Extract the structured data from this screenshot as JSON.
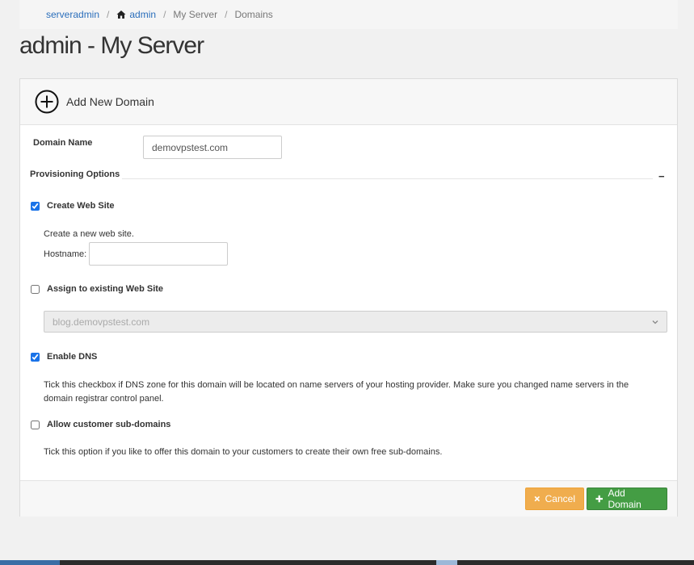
{
  "breadcrumb": {
    "items": [
      "serveradmin",
      "admin",
      "My Server",
      "Domains"
    ],
    "separator": "/"
  },
  "page": {
    "title": "admin - My Server"
  },
  "panel": {
    "title": "Add New Domain"
  },
  "form": {
    "domain_label": "Domain Name",
    "domain_value": "demovpstest.com",
    "section_title": "Provisioning Options",
    "collapse_symbol": "−",
    "create_site": {
      "label": "Create Web Site",
      "checked": true,
      "description": "Create a new web site.",
      "hostname_label": "Hostname:",
      "hostname_value": ""
    },
    "assign_site": {
      "label": "Assign to existing Web Site",
      "checked": false,
      "selected_option": "blog.demovpstest.com"
    },
    "enable_dns": {
      "label": "Enable DNS",
      "checked": true,
      "description": "Tick this checkbox if DNS zone for this domain will be located on name servers of your hosting provider. Make sure you changed name servers in the domain registrar control panel."
    },
    "sub_domains": {
      "label": "Allow customer sub-domains",
      "checked": false,
      "description": "Tick this option if you like to offer this domain to your customers to create their own free sub-domains."
    }
  },
  "buttons": {
    "cancel": "Cancel",
    "add": "Add Domain"
  },
  "colors": {
    "link": "#2a6ebb",
    "cancel": "#f0ad4e",
    "add": "#449d44"
  }
}
